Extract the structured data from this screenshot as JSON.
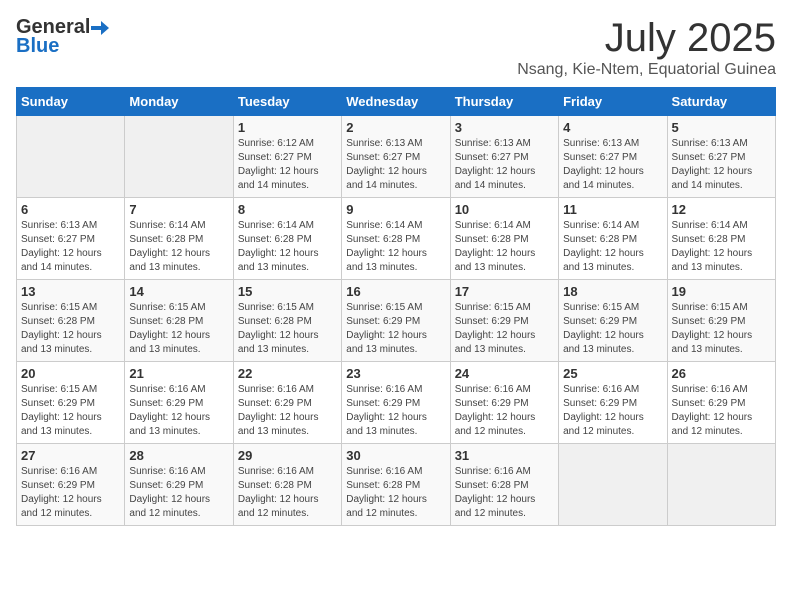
{
  "logo": {
    "general": "General",
    "blue": "Blue"
  },
  "header": {
    "month": "July 2025",
    "location": "Nsang, Kie-Ntem, Equatorial Guinea"
  },
  "days_of_week": [
    "Sunday",
    "Monday",
    "Tuesday",
    "Wednesday",
    "Thursday",
    "Friday",
    "Saturday"
  ],
  "weeks": [
    [
      {
        "day": "",
        "info": ""
      },
      {
        "day": "",
        "info": ""
      },
      {
        "day": "1",
        "info": "Sunrise: 6:12 AM\nSunset: 6:27 PM\nDaylight: 12 hours and 14 minutes."
      },
      {
        "day": "2",
        "info": "Sunrise: 6:13 AM\nSunset: 6:27 PM\nDaylight: 12 hours and 14 minutes."
      },
      {
        "day": "3",
        "info": "Sunrise: 6:13 AM\nSunset: 6:27 PM\nDaylight: 12 hours and 14 minutes."
      },
      {
        "day": "4",
        "info": "Sunrise: 6:13 AM\nSunset: 6:27 PM\nDaylight: 12 hours and 14 minutes."
      },
      {
        "day": "5",
        "info": "Sunrise: 6:13 AM\nSunset: 6:27 PM\nDaylight: 12 hours and 14 minutes."
      }
    ],
    [
      {
        "day": "6",
        "info": "Sunrise: 6:13 AM\nSunset: 6:27 PM\nDaylight: 12 hours and 14 minutes."
      },
      {
        "day": "7",
        "info": "Sunrise: 6:14 AM\nSunset: 6:28 PM\nDaylight: 12 hours and 13 minutes."
      },
      {
        "day": "8",
        "info": "Sunrise: 6:14 AM\nSunset: 6:28 PM\nDaylight: 12 hours and 13 minutes."
      },
      {
        "day": "9",
        "info": "Sunrise: 6:14 AM\nSunset: 6:28 PM\nDaylight: 12 hours and 13 minutes."
      },
      {
        "day": "10",
        "info": "Sunrise: 6:14 AM\nSunset: 6:28 PM\nDaylight: 12 hours and 13 minutes."
      },
      {
        "day": "11",
        "info": "Sunrise: 6:14 AM\nSunset: 6:28 PM\nDaylight: 12 hours and 13 minutes."
      },
      {
        "day": "12",
        "info": "Sunrise: 6:14 AM\nSunset: 6:28 PM\nDaylight: 12 hours and 13 minutes."
      }
    ],
    [
      {
        "day": "13",
        "info": "Sunrise: 6:15 AM\nSunset: 6:28 PM\nDaylight: 12 hours and 13 minutes."
      },
      {
        "day": "14",
        "info": "Sunrise: 6:15 AM\nSunset: 6:28 PM\nDaylight: 12 hours and 13 minutes."
      },
      {
        "day": "15",
        "info": "Sunrise: 6:15 AM\nSunset: 6:28 PM\nDaylight: 12 hours and 13 minutes."
      },
      {
        "day": "16",
        "info": "Sunrise: 6:15 AM\nSunset: 6:29 PM\nDaylight: 12 hours and 13 minutes."
      },
      {
        "day": "17",
        "info": "Sunrise: 6:15 AM\nSunset: 6:29 PM\nDaylight: 12 hours and 13 minutes."
      },
      {
        "day": "18",
        "info": "Sunrise: 6:15 AM\nSunset: 6:29 PM\nDaylight: 12 hours and 13 minutes."
      },
      {
        "day": "19",
        "info": "Sunrise: 6:15 AM\nSunset: 6:29 PM\nDaylight: 12 hours and 13 minutes."
      }
    ],
    [
      {
        "day": "20",
        "info": "Sunrise: 6:15 AM\nSunset: 6:29 PM\nDaylight: 12 hours and 13 minutes."
      },
      {
        "day": "21",
        "info": "Sunrise: 6:16 AM\nSunset: 6:29 PM\nDaylight: 12 hours and 13 minutes."
      },
      {
        "day": "22",
        "info": "Sunrise: 6:16 AM\nSunset: 6:29 PM\nDaylight: 12 hours and 13 minutes."
      },
      {
        "day": "23",
        "info": "Sunrise: 6:16 AM\nSunset: 6:29 PM\nDaylight: 12 hours and 13 minutes."
      },
      {
        "day": "24",
        "info": "Sunrise: 6:16 AM\nSunset: 6:29 PM\nDaylight: 12 hours and 12 minutes."
      },
      {
        "day": "25",
        "info": "Sunrise: 6:16 AM\nSunset: 6:29 PM\nDaylight: 12 hours and 12 minutes."
      },
      {
        "day": "26",
        "info": "Sunrise: 6:16 AM\nSunset: 6:29 PM\nDaylight: 12 hours and 12 minutes."
      }
    ],
    [
      {
        "day": "27",
        "info": "Sunrise: 6:16 AM\nSunset: 6:29 PM\nDaylight: 12 hours and 12 minutes."
      },
      {
        "day": "28",
        "info": "Sunrise: 6:16 AM\nSunset: 6:29 PM\nDaylight: 12 hours and 12 minutes."
      },
      {
        "day": "29",
        "info": "Sunrise: 6:16 AM\nSunset: 6:28 PM\nDaylight: 12 hours and 12 minutes."
      },
      {
        "day": "30",
        "info": "Sunrise: 6:16 AM\nSunset: 6:28 PM\nDaylight: 12 hours and 12 minutes."
      },
      {
        "day": "31",
        "info": "Sunrise: 6:16 AM\nSunset: 6:28 PM\nDaylight: 12 hours and 12 minutes."
      },
      {
        "day": "",
        "info": ""
      },
      {
        "day": "",
        "info": ""
      }
    ]
  ]
}
